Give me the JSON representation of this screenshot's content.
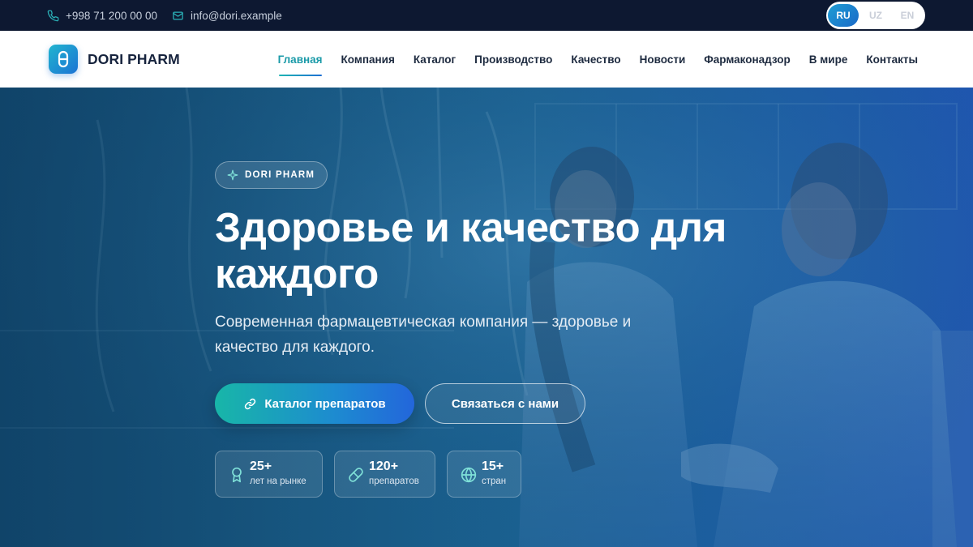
{
  "topbar": {
    "phone": "+998 71 200 00 00",
    "email": "info@dori.example",
    "languages": [
      {
        "label": "RU",
        "active": true
      },
      {
        "label": "UZ",
        "active": false
      },
      {
        "label": "EN",
        "active": false
      }
    ]
  },
  "nav": {
    "logo_icon": "pill-capsule-icon",
    "brand": "DORI PHARM",
    "items": [
      {
        "label": "Главная",
        "active": true
      },
      {
        "label": "Компания"
      },
      {
        "label": "Каталог"
      },
      {
        "label": "Производство"
      },
      {
        "label": "Качество"
      },
      {
        "label": "Новости"
      },
      {
        "label": "Фармаконадзор"
      },
      {
        "label": "В мире"
      },
      {
        "label": "Контакты"
      }
    ]
  },
  "hero": {
    "badge": "DORI PHARM",
    "title_line1": "Здоровье и качество для",
    "title_line2": "каждого",
    "subtitle_line1": "Современная фармацевтическая компания — здоровье и",
    "subtitle_line2": "качество для каждого.",
    "primary_button": "Каталог препаратов",
    "secondary_button": "Связаться с нами",
    "stats": [
      {
        "value": "25+",
        "label": "лет на рынке",
        "icon": "award-icon"
      },
      {
        "value": "120+",
        "label": "препаратов",
        "icon": "pill-icon"
      },
      {
        "value": "15+",
        "label": "стран",
        "icon": "globe-icon"
      }
    ]
  },
  "colors": {
    "topbar_bg": "#0d1831",
    "accent_teal": "#1a9aa8",
    "accent_blue": "#1d6fd4",
    "brand_text": "#16233d"
  }
}
